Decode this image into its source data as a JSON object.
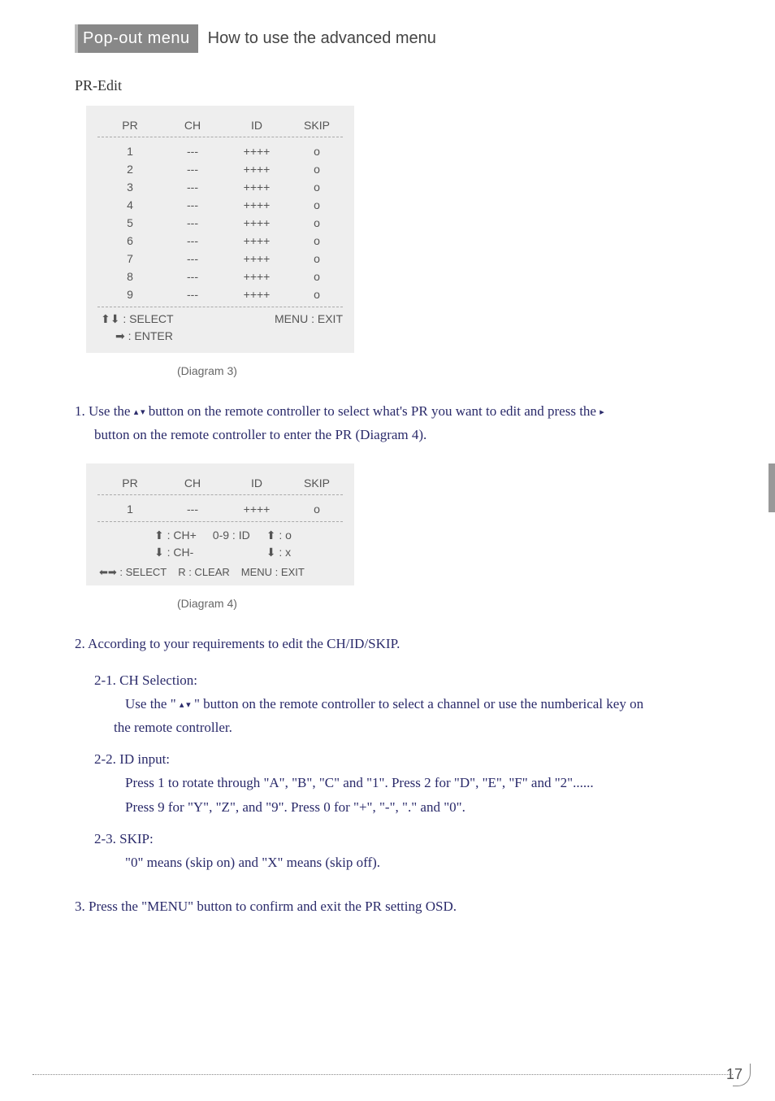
{
  "header": {
    "dark": "Pop-out menu",
    "light": "How to use the advanced menu"
  },
  "section_title": "PR-Edit",
  "diagram3": {
    "cols": {
      "pr": "PR",
      "ch": "CH",
      "id": "ID",
      "skip": "SKIP"
    },
    "rows": [
      {
        "pr": "1",
        "ch": "---",
        "id": "++++",
        "skip": "o"
      },
      {
        "pr": "2",
        "ch": "---",
        "id": "++++",
        "skip": "o"
      },
      {
        "pr": "3",
        "ch": "---",
        "id": "++++",
        "skip": "o"
      },
      {
        "pr": "4",
        "ch": "---",
        "id": "++++",
        "skip": "o"
      },
      {
        "pr": "5",
        "ch": "---",
        "id": "++++",
        "skip": "o"
      },
      {
        "pr": "6",
        "ch": "---",
        "id": "++++",
        "skip": "o"
      },
      {
        "pr": "7",
        "ch": "---",
        "id": "++++",
        "skip": "o"
      },
      {
        "pr": "8",
        "ch": "---",
        "id": "++++",
        "skip": "o"
      },
      {
        "pr": "9",
        "ch": "---",
        "id": "++++",
        "skip": "o"
      }
    ],
    "footer": {
      "select": "⬆⬇ : SELECT",
      "menu": "MENU : EXIT",
      "enter": "➡ : ENTER"
    },
    "caption": "(Diagram 3)"
  },
  "step1": {
    "line1a": "1. Use the ",
    "arrows": "▴ ▾",
    "line1b": " button on the remote controller to select what's PR you want to edit and press the ",
    "right": "▸",
    "line2": "button on the remote controller to enter the PR (Diagram 4)."
  },
  "diagram4": {
    "cols": {
      "pr": "PR",
      "ch": "CH",
      "id": "ID",
      "skip": "SKIP"
    },
    "row": {
      "pr": "1",
      "ch": "---",
      "id": "++++",
      "skip": "o"
    },
    "hints": {
      "ch_up": "⬆ : CH+",
      "ch_down": "⬇ : CH-",
      "id": "0-9 : ID",
      "skip_o": "⬆ : o",
      "skip_x": "⬇ : x"
    },
    "footer": {
      "select": "⬅➡ : SELECT",
      "clear": "R : CLEAR",
      "menu": "MENU : EXIT"
    },
    "caption": "(Diagram 4)"
  },
  "step2": "2. According to your requirements to edit the CH/ID/SKIP.",
  "s21": {
    "head": "2-1. CH Selection:",
    "body1a": "Use the \" ",
    "arrows": "▴ ▾",
    "body1b": " \" button on the remote controller to select a channel or use the numberical key on",
    "body2": "the remote controller."
  },
  "s22": {
    "head": "2-2. ID input:",
    "body1": "Press 1 to rotate through \"A\", \"B\", \"C\" and \"1\". Press 2 for \"D\", \"E\", \"F\" and \"2\"......",
    "body2": "Press 9 for \"Y\", \"Z\", and \"9\". Press 0 for \"+\", \"-\", \".\" and \"0\"."
  },
  "s23": {
    "head": "2-3. SKIP:",
    "body": "\"0\" means (skip on) and \"X\" means (skip off)."
  },
  "step3": "3. Press the \"MENU\" button to confirm and exit the PR setting OSD.",
  "page_number": "17"
}
